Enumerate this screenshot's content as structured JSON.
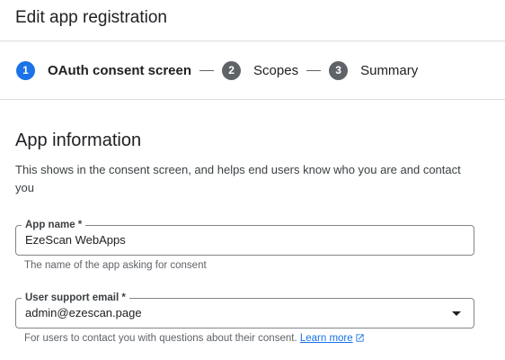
{
  "header": {
    "title": "Edit app registration"
  },
  "stepper": {
    "steps": [
      {
        "number": "1",
        "label": "OAuth consent screen",
        "active": true
      },
      {
        "number": "2",
        "label": "Scopes",
        "active": false
      },
      {
        "number": "3",
        "label": "Summary",
        "active": false
      }
    ],
    "active_color": "#1a73e8",
    "inactive_color": "#5f6368"
  },
  "section": {
    "title": "App information",
    "description": "This shows in the consent screen, and helps end users know who you are and contact you"
  },
  "app_name_field": {
    "label": "App name *",
    "value": "EzeScan WebApps",
    "hint": "The name of the app asking for consent"
  },
  "support_email_field": {
    "label": "User support email *",
    "value": "admin@ezescan.page",
    "icon": "dropdown-arrow-icon",
    "hint": "For users to contact you with questions about their consent.",
    "link_label": "Learn more",
    "link_icon": "external-link-icon",
    "link_color": "#1a73e8"
  }
}
